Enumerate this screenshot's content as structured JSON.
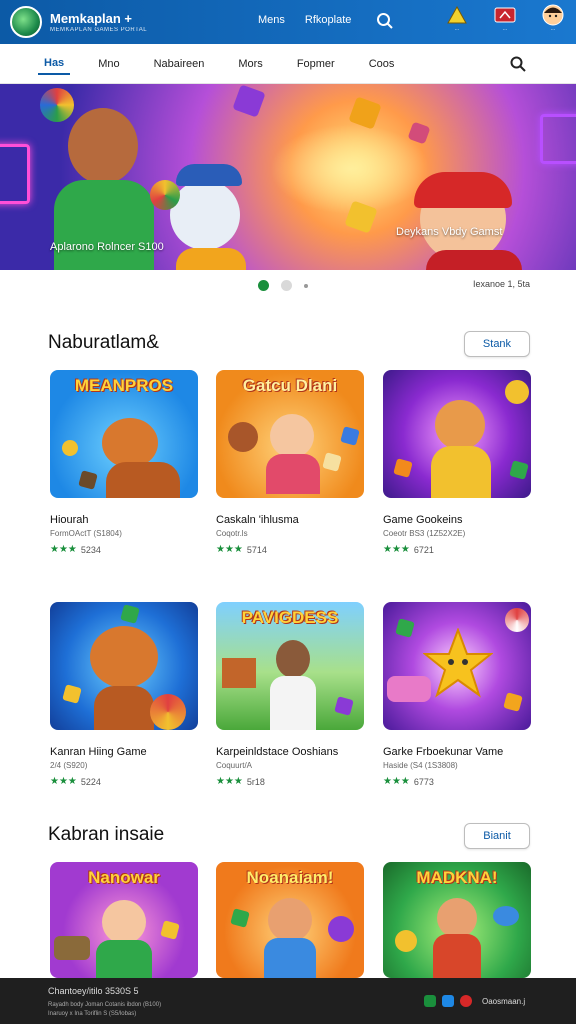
{
  "brand": {
    "title": "Memkaplan +",
    "subtitle": "MEMKAPLAN GAMES PORTAL"
  },
  "top_links": [
    "Mens",
    "Rfkoplate"
  ],
  "top_icons": [
    {
      "icon": "triangle-badge-icon",
      "label": "..."
    },
    {
      "icon": "flag-icon",
      "label": "..."
    },
    {
      "icon": "avatar-icon",
      "label": "..."
    }
  ],
  "nav_tabs": [
    "Has",
    "Mno",
    "Nabaireen",
    "Mors",
    "Fopmer",
    "Coos"
  ],
  "active_tab": 0,
  "banner": {
    "left_caption": "Aplarono Rolncer S100",
    "right_caption": "Deykans Vbdy Gamst"
  },
  "carousel": {
    "dots": 2,
    "active": 0,
    "page_label": "Iexanoe 1, 5ta"
  },
  "section1": {
    "title": "Naburatlam&",
    "button": "Stank",
    "cards": [
      {
        "thumb_title": "MEANPROS",
        "name": "Hiourah",
        "sub": "FormOActT (S1804)",
        "stars": "★★★",
        "count": "5234"
      },
      {
        "thumb_title": "Gatcu Dlani",
        "name": "Caskaln 'ihlusma",
        "sub": "Coqotr.ls",
        "stars": "★★★",
        "count": "5714"
      },
      {
        "thumb_title": "",
        "name": "Game Gookeins",
        "sub": "Coeotr BS3 (1Z52X2E)",
        "stars": "★★★",
        "count": "6721"
      },
      {
        "thumb_title": "",
        "name": "Kanran Hiing Game",
        "sub": "2/4 (S920)",
        "stars": "★★★",
        "count": "5224"
      },
      {
        "thumb_title": "PAVIGDESS",
        "name": "Karpeinldstace Ooshians",
        "sub": "Coquurt/A",
        "stars": "★★★",
        "count": "5r18"
      },
      {
        "thumb_title": "",
        "name": "Garke Frboekunar Vame",
        "sub": "Haside (S4 (1S3808)",
        "stars": "★★★",
        "count": "6773"
      }
    ]
  },
  "section2": {
    "title": "Kabran insaie",
    "button": "Bianit",
    "cards": [
      {
        "thumb_title": "Nanowar"
      },
      {
        "thumb_title": "Noanaiam!"
      },
      {
        "thumb_title": "MADKNA!"
      }
    ]
  },
  "footer": {
    "line1": "Chantoey/itilo 3530S 5",
    "line2": "Rayadh body Joman Cotanis ibdon (B100)",
    "line3": "Inaruoy x Ina Toriflin S (S5/lobas)",
    "right_text": "Oaosmaan.j",
    "icons": [
      "check-icon",
      "send-icon",
      "pinterest-icon"
    ]
  },
  "colors": {
    "brand_blue": "#0c5aa6",
    "green": "#1a8f3c",
    "footer_bg": "#1f1f1f"
  }
}
